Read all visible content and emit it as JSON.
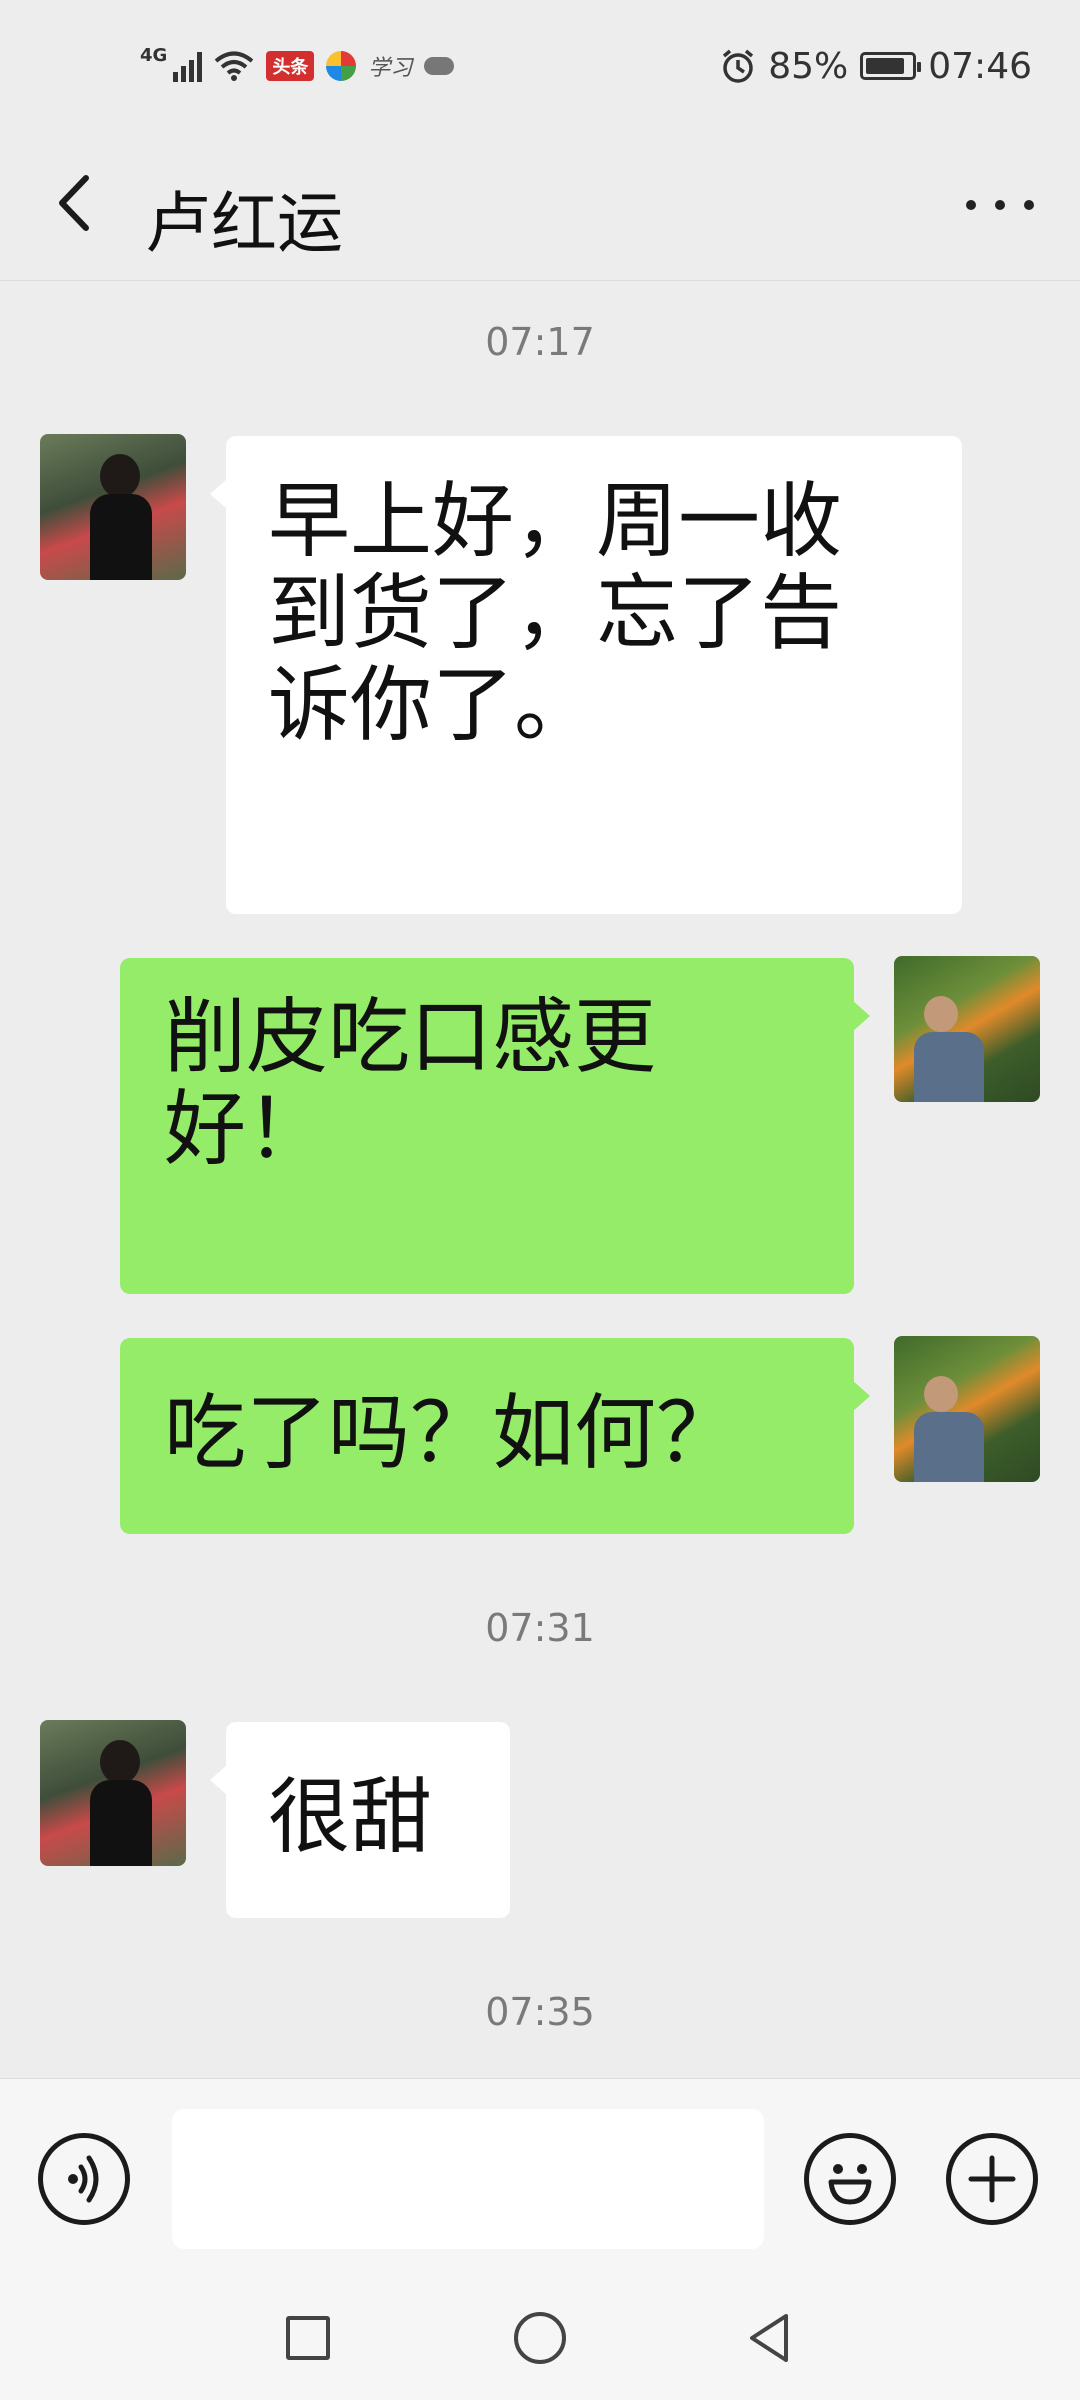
{
  "status_bar": {
    "network": "4G",
    "app_badge": "头条",
    "app_badge_2": "学习",
    "battery_level": 85,
    "battery": "85%",
    "time": "07:46"
  },
  "header": {
    "back_icon": "chevron-left-icon",
    "title": "卢红运",
    "more_icon": "more-horizontal-icon"
  },
  "messages": [
    {
      "type": "timestamp",
      "text": "07:17"
    },
    {
      "type": "incoming",
      "lines": [
        "早上好，周一收",
        "到货了，忘了告",
        "诉你了。"
      ]
    },
    {
      "type": "outgoing",
      "lines": [
        "削皮吃口感更",
        "好！"
      ]
    },
    {
      "type": "outgoing",
      "lines": [
        "吃了吗？如何？"
      ]
    },
    {
      "type": "timestamp",
      "text": "07:31"
    },
    {
      "type": "incoming",
      "lines": [
        "很甜"
      ]
    },
    {
      "type": "timestamp",
      "text": "07:35"
    }
  ],
  "input_bar": {
    "voice_icon": "voice-icon",
    "emoji_icon": "emoji-icon",
    "plus_icon": "plus-icon",
    "text_value": ""
  },
  "nav_bar": {
    "recents_icon": "square-icon",
    "home_icon": "circle-icon",
    "back_icon": "triangle-back-icon"
  },
  "colors": {
    "background": "#ededed",
    "incoming_bubble": "#ffffff",
    "outgoing_bubble": "#95ec69"
  }
}
